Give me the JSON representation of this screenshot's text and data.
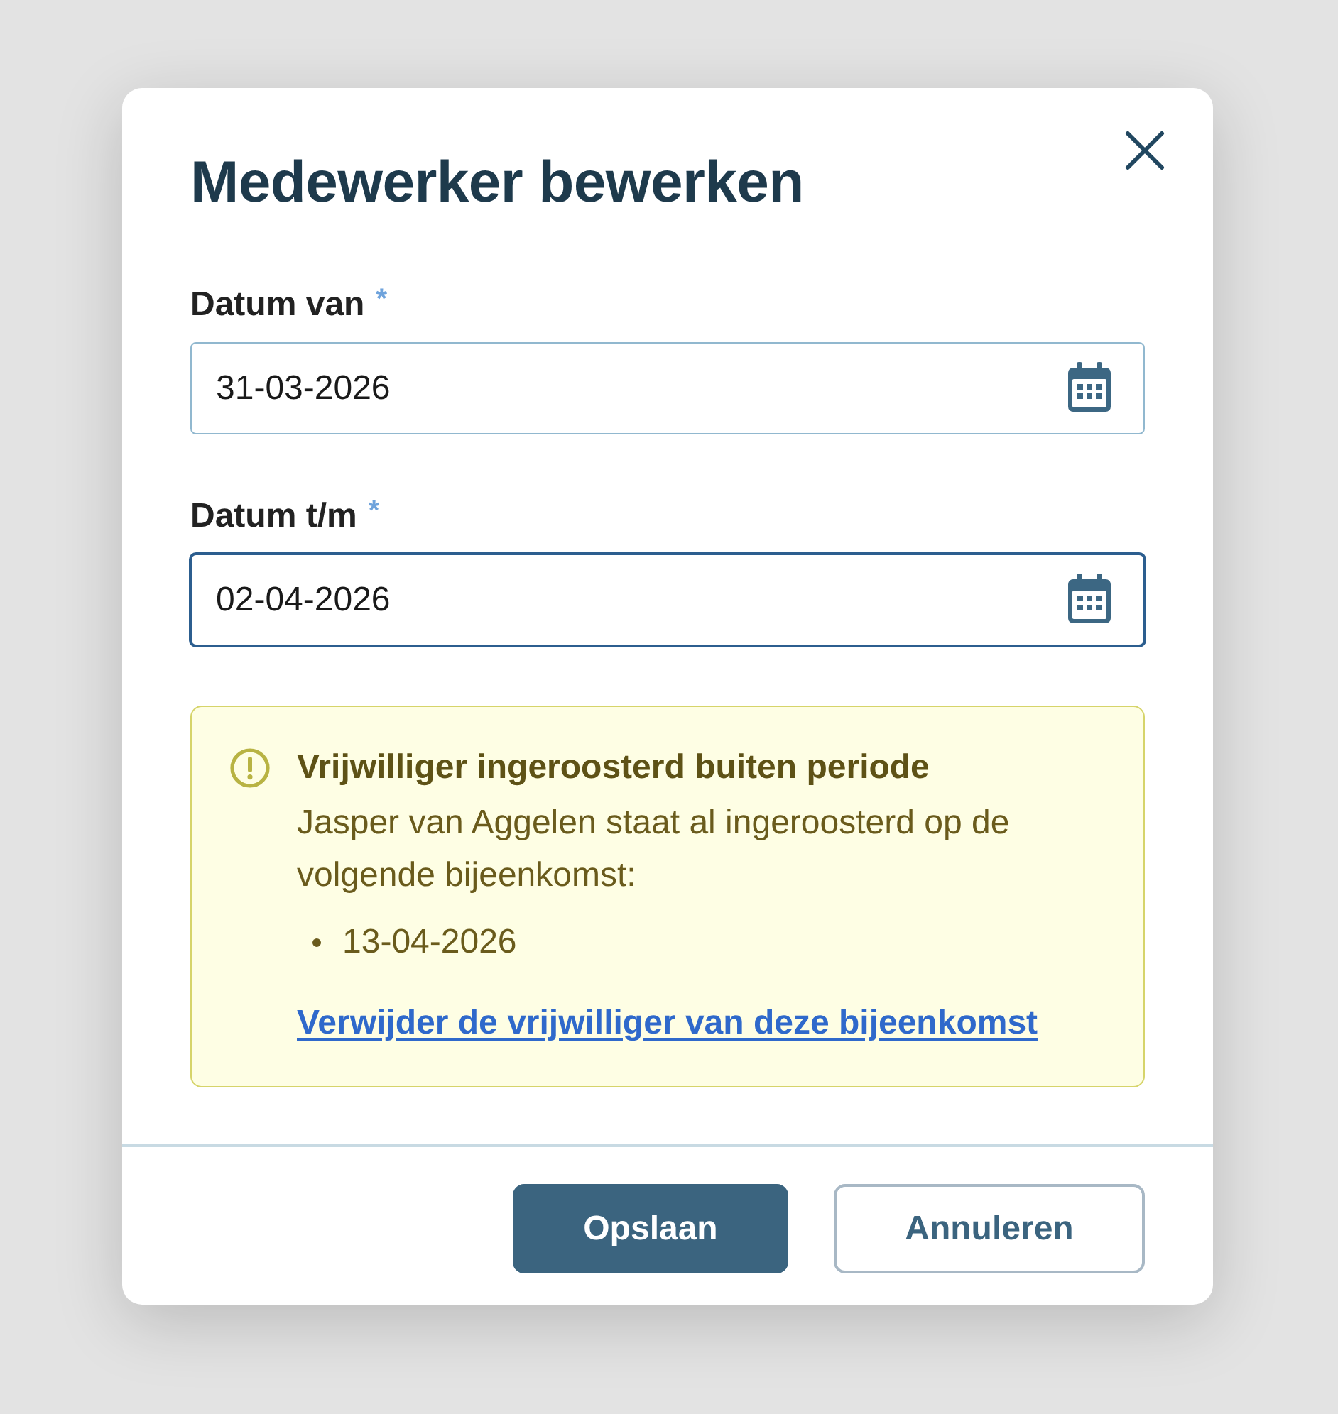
{
  "dialog": {
    "title": "Medewerker bewerken"
  },
  "fields": [
    {
      "label": "Datum van",
      "required_mark": "*",
      "value": "31-03-2026",
      "focused": false
    },
    {
      "label": "Datum t/m",
      "required_mark": "*",
      "value": "02-04-2026",
      "focused": true
    }
  ],
  "alert": {
    "kind": "warning",
    "title": "Vrijwilliger ingeroosterd buiten periode",
    "message": "Jasper van Aggelen staat al ingeroosterd op de volgende bijeenkomst:",
    "items": [
      "13-04-2026"
    ],
    "link": "Verwijder de vrijwilliger van deze bijeenkomst"
  },
  "buttons": [
    {
      "label": "Opslaan",
      "kind": "primary"
    },
    {
      "label": "Annuleren",
      "kind": "secondary"
    }
  ]
}
